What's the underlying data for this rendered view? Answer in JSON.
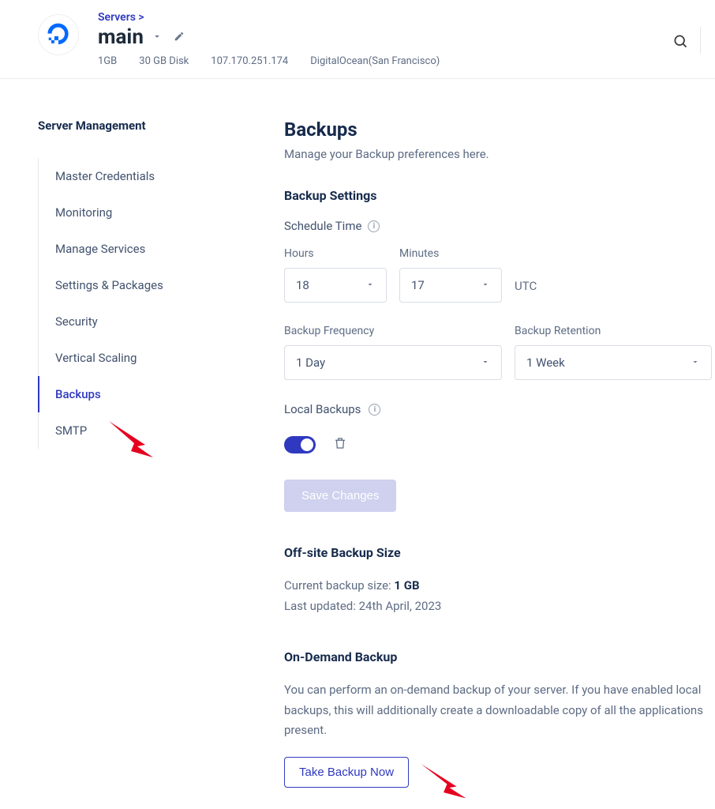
{
  "header": {
    "breadcrumb": "Servers >",
    "server_name": "main",
    "meta": {
      "ram": "1GB",
      "disk": "30 GB Disk",
      "ip": "107.170.251.174",
      "provider": "DigitalOcean(San Francisco)"
    }
  },
  "sidebar": {
    "title": "Server Management",
    "items": [
      {
        "label": "Master Credentials"
      },
      {
        "label": "Monitoring"
      },
      {
        "label": "Manage Services"
      },
      {
        "label": "Settings & Packages"
      },
      {
        "label": "Security"
      },
      {
        "label": "Vertical Scaling"
      },
      {
        "label": "Backups"
      },
      {
        "label": "SMTP"
      }
    ]
  },
  "page": {
    "title": "Backups",
    "subtitle": "Manage your Backup preferences here.",
    "settings_heading": "Backup Settings",
    "schedule_label": "Schedule Time",
    "hours_label": "Hours",
    "minutes_label": "Minutes",
    "hours_value": "18",
    "minutes_value": "17",
    "utc_label": "UTC",
    "freq_label": "Backup Frequency",
    "freq_value": "1 Day",
    "retention_label": "Backup Retention",
    "retention_value": "1 Week",
    "local_label": "Local Backups",
    "save_label": "Save Changes",
    "offsite_heading": "Off-site Backup Size",
    "offsite_line1_pre": "Current backup size: ",
    "offsite_line1_bold": "1 GB",
    "offsite_line2": "Last updated: 24th April, 2023",
    "ondemand_heading": "On-Demand Backup",
    "ondemand_text": "You can perform an on-demand backup of your server. If you have enabled local backups, this will additionally create a downloadable copy of all the applications present.",
    "ondemand_button": "Take Backup Now"
  }
}
